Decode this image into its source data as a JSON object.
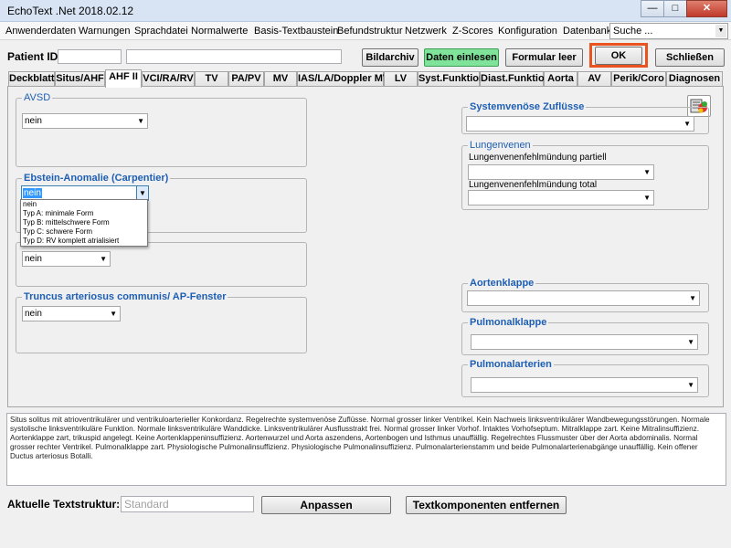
{
  "window": {
    "title": "EchoText .Net 2018.02.12"
  },
  "menu": [
    "Anwenderdaten",
    "Warnungen",
    "Sprachdatei",
    "Normalwerte",
    "Basis-Textbaustein",
    "Befundstruktur",
    "Netzwerk",
    "Z-Scores",
    "Konfiguration",
    "Datenbank"
  ],
  "search": {
    "value": "Suche ..."
  },
  "patient": {
    "label": "Patient ID",
    "id_value": "",
    "name_value": ""
  },
  "buttons": {
    "bildarchiv": "Bildarchiv",
    "daten_einlesen": "Daten einlesen",
    "formular_leer": "Formular leer",
    "ok": "OK",
    "schliessen": "Schließen",
    "anpassen": "Anpassen",
    "textkomponenten": "Textkomponenten entfernen"
  },
  "tabs": [
    "Deckblatt",
    "Situs/AHF",
    "AHF II",
    "VCI/RA/RV",
    "TV",
    "PA/PV",
    "MV",
    "IAS/LA/Doppler MV",
    "LV",
    "Syst.Funktion",
    "Diast.Funktion",
    "Aorta",
    "AV",
    "Perik/Coro",
    "Diagnosen"
  ],
  "active_tab": "AHF II",
  "left": {
    "avsd": {
      "legend": "AVSD",
      "value": "nein"
    },
    "ebstein": {
      "legend": "Ebstein-Anomalie (Carpentier)",
      "value": "nein",
      "options": [
        "nein",
        "Typ A: minimale Form",
        "Typ B: mittelschwere Form",
        "Typ C: schwere Form",
        "Typ D: RV komplett atrialisiert"
      ]
    },
    "hidden_group": {
      "value": "nein"
    },
    "truncus": {
      "legend": "Truncus arteriosus communis/ AP-Fenster",
      "value": "nein"
    }
  },
  "right": {
    "systemvenoese": {
      "legend": "Systemvenöse Zuflüsse",
      "value": ""
    },
    "lungenvenen": {
      "legend": "Lungenvenen",
      "partiell_label": "Lungenvenenfehlmündung partiell",
      "partiell_value": "",
      "total_label": "Lungenvenenfehlmündung total",
      "total_value": ""
    },
    "aortenklappe": {
      "legend": "Aortenklappe",
      "value": ""
    },
    "pulmonalklappe": {
      "legend": "Pulmonalklappe",
      "value": ""
    },
    "pulmonalarterien": {
      "legend": "Pulmonalarterien",
      "value": ""
    }
  },
  "report_text": "Situs solitus mit atrioventrikulärer und ventrikuloarterieller Konkordanz. Regelrechte systemvenöse Zuflüsse. Normal grosser linker Ventrikel. Kein Nachweis linksventrikulärer Wandbewegungsstörungen. Normale systolische linksventrikuläre Funktion. Normale linksventrikuläre Wanddicke. Linksventrikulärer Ausflusstrakt frei. Normal grosser linker Vorhof. Intaktes Vorhofseptum. Mitralklappe zart. Keine Mitralinsuffizienz. Aortenklappe zart, trikuspid angelegt. Keine Aortenklappeninsuffizienz. Aortenwurzel und Aorta aszendens, Aortenbogen und Isthmus unauffällig. Regelrechtes Flussmuster über der Aorta abdominalis. Normal grosser rechter Ventrikel. Pulmonalklappe zart. Physiologische Pulmonalinsuffizienz. Physiologische Pulmonalinsuffizienz. Pulmonalarterienstamm und beide Pulmonalarterienabgänge unauffällig. Kein offener Ductus arteriosus Botalli.",
  "bottom": {
    "label": "Aktuelle Textstruktur:",
    "value": "Standard"
  },
  "colors": {
    "legend_blue": "#1e5fb4",
    "ok_highlight": "#e8531f",
    "green_button": "#7fe39a"
  }
}
